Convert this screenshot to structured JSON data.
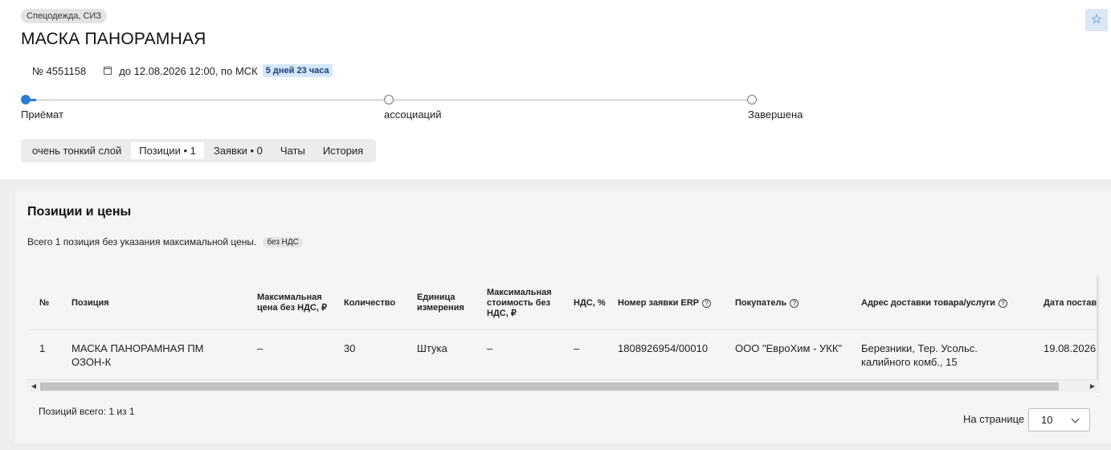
{
  "header": {
    "category": "Спецодежда, СИЗ",
    "title": "МАСКА ПАНОРАМНАЯ",
    "number": "№ 4551158",
    "deadline": "до 12.08.2026 12:00, по МСК",
    "time_left": "5 дней 23 часа",
    "favorite_icon": "☆"
  },
  "stepper": {
    "steps": [
      {
        "label": "Приёмат"
      },
      {
        "label": "ассоциаций"
      },
      {
        "label": "Завершена"
      }
    ]
  },
  "tabs": [
    {
      "label": "очень тонкий слой"
    },
    {
      "label": "Позиции • 1"
    },
    {
      "label": "Заявки • 0"
    },
    {
      "label": "Чаты"
    },
    {
      "label": "История"
    }
  ],
  "positions": {
    "title": "Позиции и цены",
    "summary": "Всего 1 позиция без указания максимальной цены.",
    "vat_chip": "без НДС",
    "columns": [
      "№",
      "Позиция",
      "Максимальная цена без НДС, ₽",
      "Количество",
      "Единица измерения",
      "Максимальная стоимость без НДС, ₽",
      "НДС, %",
      "Номер заявки ERP",
      "Покупатель",
      "Адрес доставки товара/услуги",
      "Дата поставки"
    ],
    "rows": [
      {
        "n": "1",
        "position": "МАСКА ПАНОРАМНАЯ ПМ ОЗОН-К",
        "max_price": "–",
        "quantity": "30",
        "unit": "Штука",
        "max_cost": "–",
        "vat": "–",
        "erp": "1808926954/00010",
        "buyer": "ООО \"ЕвроХим - УКК\"",
        "address": "Березники, Тер. Усольс. калийного комб., 15",
        "date": "19.08.2026"
      }
    ],
    "total": "Позиций всего: 1 из 1",
    "per_page_label": "На странице",
    "per_page_value": "10"
  },
  "accent_color": "#2b7cd3"
}
